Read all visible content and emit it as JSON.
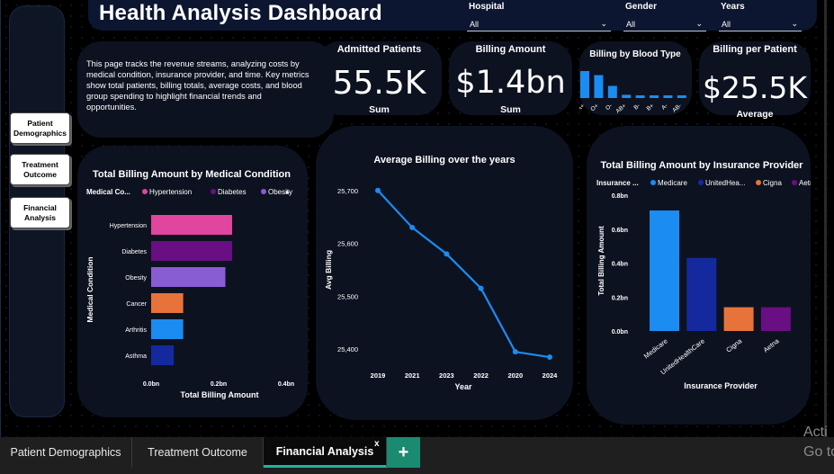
{
  "header": {
    "title": "Health Analysis Dashboard"
  },
  "slicers": [
    {
      "label": "Hospital",
      "value": "All"
    },
    {
      "label": "Gender",
      "value": "All"
    },
    {
      "label": "Years",
      "value": "All"
    }
  ],
  "nav": {
    "buttons": [
      {
        "label": "Patient Demographics"
      },
      {
        "label": "Treatment Outcome"
      },
      {
        "label": "Financial Analysis"
      }
    ]
  },
  "description": "This page tracks the revenue streams, analyzing costs by medical condition, insurance provider, and time. Key metrics show total patients, billing totals, average costs, and blood group spending to highlight financial trends and opportunities.",
  "kpis": {
    "admitted": {
      "label": "Admitted Patients",
      "value": "55.5K",
      "sub": "Sum"
    },
    "billing": {
      "label": "Billing Amount",
      "value": "$1.4bn",
      "sub": "Sum"
    },
    "per_patient": {
      "label": "Billing per Patient",
      "value": "$25.5K",
      "sub": "Average"
    }
  },
  "chart_data": [
    {
      "id": "blood",
      "type": "bar",
      "title": "Billing by Blood Type",
      "categories": [
        "A+",
        "O+",
        "O-",
        "AB+",
        "B-",
        "B+",
        "A-",
        "AB-"
      ],
      "values": [
        1.0,
        0.85,
        0.45,
        0.12,
        0.1,
        0.1,
        0.1,
        0.1
      ],
      "color": "#1b8cf2"
    },
    {
      "id": "condition",
      "type": "bar",
      "orientation": "horizontal",
      "title": "Total Billing Amount by Medical Condition",
      "legend_title": "Medical Co...",
      "legend": [
        {
          "name": "Hypertension",
          "color": "#e0459f"
        },
        {
          "name": "Diabetes",
          "color": "#6a0e84"
        },
        {
          "name": "Obesity",
          "color": "#8a5cd4"
        }
      ],
      "categories": [
        "Hypertension",
        "Diabetes",
        "Obesity",
        "Cancer",
        "Arthritis",
        "Asthma"
      ],
      "values": [
        0.24,
        0.24,
        0.22,
        0.095,
        0.095,
        0.067
      ],
      "colors": [
        "#e0459f",
        "#6a0e84",
        "#8a5cd4",
        "#e8733a",
        "#1b8cf2",
        "#15299e"
      ],
      "xlabel": "Total Billing Amount",
      "ylabel": "Medical Condition",
      "xticks": [
        "0.0bn",
        "0.2bn",
        "0.4bn"
      ],
      "xlim": [
        0,
        0.4
      ]
    },
    {
      "id": "years",
      "type": "line",
      "title": "Average Billing over the years",
      "categories": [
        "2019",
        "2021",
        "2023",
        "2022",
        "2020",
        "2024"
      ],
      "values": [
        25700,
        25630,
        25580,
        25515,
        25395,
        25385
      ],
      "color": "#1b8cf2",
      "xlabel": "Year",
      "ylabel": "Avg Billing",
      "yticks": [
        "25,400",
        "25,500",
        "25,600",
        "25,700"
      ],
      "ylim": [
        25380,
        25720
      ]
    },
    {
      "id": "insurance",
      "type": "bar",
      "title": "Total Billing Amount by Insurance Provider",
      "legend_title": "Insurance ...",
      "legend": [
        {
          "name": "Medicare",
          "color": "#1b8cf2"
        },
        {
          "name": "UnitedHea...",
          "color": "#15299e"
        },
        {
          "name": "Cigna",
          "color": "#e8733a"
        },
        {
          "name": "Aetna",
          "color": "#6a0e84"
        }
      ],
      "categories": [
        "Medicare",
        "UnitedHealthCare",
        "Cigna",
        "Aetna"
      ],
      "values": [
        0.71,
        0.43,
        0.14,
        0.14
      ],
      "colors": [
        "#1b8cf2",
        "#15299e",
        "#e8733a",
        "#6a0e84"
      ],
      "xlabel": "Insurance Provider",
      "ylabel": "Total Billing Amount",
      "yticks": [
        "0.0bn",
        "0.2bn",
        "0.4bn",
        "0.6bn",
        "0.8bn"
      ],
      "ylim": [
        0,
        0.8
      ]
    }
  ],
  "tabs": [
    {
      "label": "Patient Demographics"
    },
    {
      "label": "Treatment Outcome"
    },
    {
      "label": "Financial Analysis"
    }
  ],
  "tab_actions": {
    "close": "x",
    "add": "+"
  },
  "watermark": {
    "line1": "Acti",
    "line2": "Go to"
  }
}
